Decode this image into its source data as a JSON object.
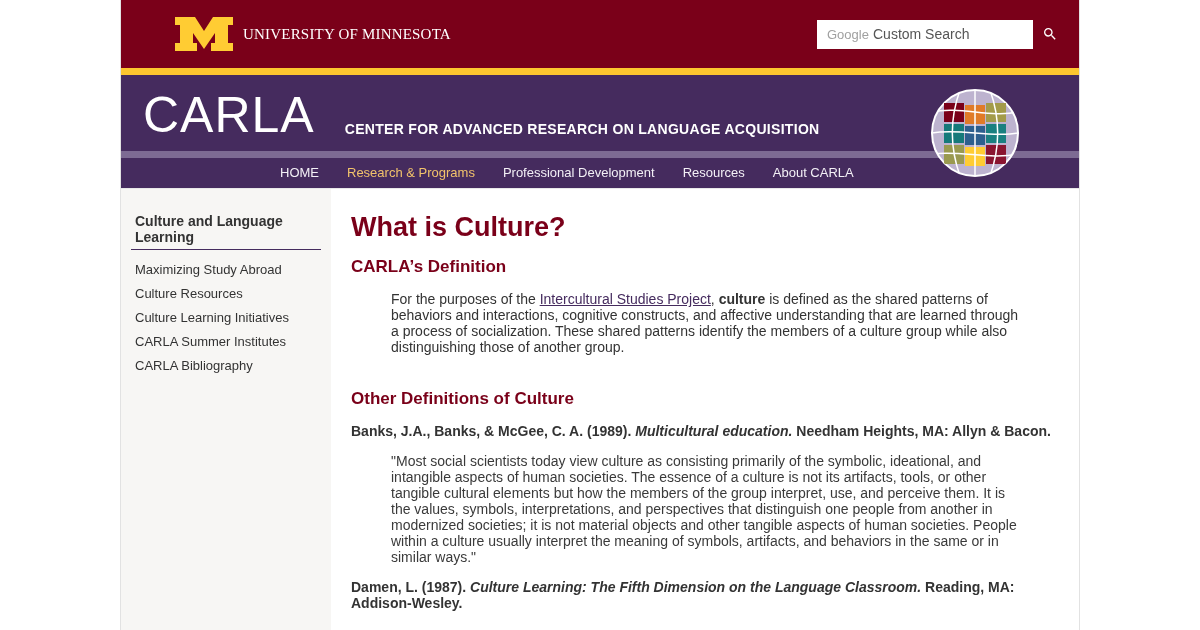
{
  "header": {
    "university": "UNIVERSITY OF MINNESOTA",
    "search": {
      "brand": "Google",
      "placeholder": "Custom Search"
    }
  },
  "banner": {
    "title": "CARLA",
    "subtitle": "CENTER FOR ADVANCED RESEARCH ON LANGUAGE ACQUISITION"
  },
  "nav": [
    {
      "label": "HOME",
      "selected": false
    },
    {
      "label": "Research & Programs",
      "selected": true
    },
    {
      "label": "Professional Development",
      "selected": false
    },
    {
      "label": "Resources",
      "selected": false
    },
    {
      "label": "About CARLA",
      "selected": false
    }
  ],
  "sidebar": {
    "heading": "Culture and Language Learning",
    "items": [
      "Maximizing Study Abroad",
      "Culture Resources",
      "Culture Learning Initiatives",
      "CARLA Summer Institutes",
      "CARLA Bibliography"
    ]
  },
  "content": {
    "title": "What is Culture?",
    "sections": [
      {
        "heading": "CARLA’s Definition",
        "blocks": [
          {
            "kind": "definition",
            "before": "For the purposes of the",
            "link": "Intercultural Studies Project",
            "after": ", **culture** is defined as the shared patterns of behaviors and interactions, cognitive constructs, and affective understanding that are learned through a process of socialization. These shared patterns identify the members of a culture group while also distinguishing those of another group."
          }
        ]
      },
      {
        "heading": "Other Definitions of Culture",
        "blocks": [
          {
            "kind": "citation",
            "text": "Banks, J.A., Banks, & McGee, C. A. (1989). *Multicultural education.* Needham Heights, MA: Allyn & Bacon."
          },
          {
            "kind": "quote",
            "text": "\"Most social scientists today view culture as consisting primarily of the symbolic, ideational, and intangible aspects of human societies. The essence of a culture is not its artifacts, tools, or other tangible cultural elements but how the members of the group interpret, use, and perceive them. It is the values, symbols, interpretations, and perspectives that distinguish one people from another in modernized societies; it is not material objects and other tangible aspects of human societies. People within a culture usually interpret the meaning of symbols, artifacts, and behaviors in the same or in similar ways.\""
          },
          {
            "kind": "citation",
            "text": "Damen, L. (1987). *Culture Learning: The Fifth Dimension on the Language Classroom.* Reading, MA: Addison-Wesley."
          }
        ]
      }
    ]
  }
}
